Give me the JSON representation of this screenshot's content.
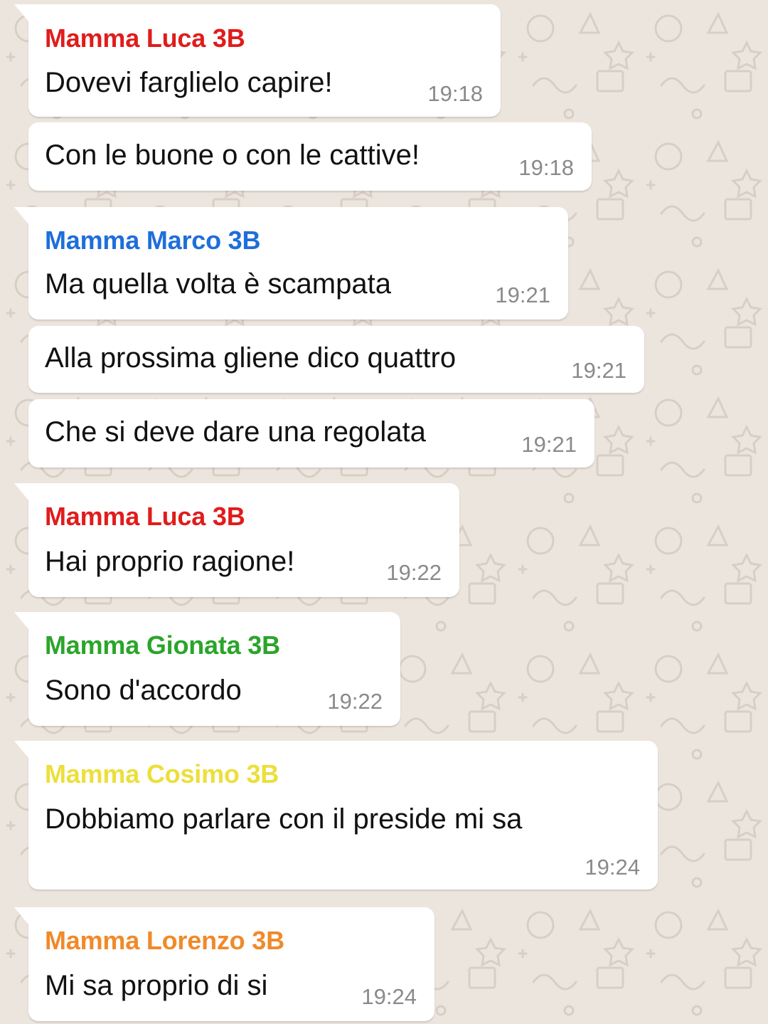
{
  "icons": {
    "wallpaper": "doodle-party-icons",
    "tail": "bubble-tail-icon"
  },
  "senders": {
    "luca": {
      "name": "Mamma Luca 3B",
      "color": "#e01c1c"
    },
    "marco": {
      "name": "Mamma Marco 3B",
      "color": "#1e6fd9"
    },
    "gionata": {
      "name": "Mamma Gionata 3B",
      "color": "#2aa52a"
    },
    "cosimo": {
      "name": "Mamma Cosimo 3B",
      "color": "#ecdf3a"
    },
    "lorenzo": {
      "name": "Mamma Lorenzo 3B",
      "color": "#f08a2a"
    }
  },
  "messages": [
    {
      "sender": "Mamma Luca 3B",
      "text": "Dovevi farglielo capire!",
      "time": "19:18"
    },
    {
      "text": "Con le buone o con le cattive!",
      "time": "19:18"
    },
    {
      "sender": "Mamma Marco 3B",
      "text": "Ma quella volta è scampata",
      "time": "19:21"
    },
    {
      "text": "Alla prossima gliene dico quattro",
      "time": "19:21"
    },
    {
      "text": "Che si deve dare una regolata",
      "time": "19:21"
    },
    {
      "sender": "Mamma Luca 3B",
      "text": "Hai proprio ragione!",
      "time": "19:22"
    },
    {
      "sender": "Mamma Gionata 3B",
      "text": "Sono d'accordo",
      "time": "19:22"
    },
    {
      "sender": "Mamma Cosimo 3B",
      "text": "Dobbiamo parlare con il preside mi sa",
      "time": "19:24"
    },
    {
      "sender": "Mamma Lorenzo 3B",
      "text": "Mi sa proprio di si",
      "time": "19:24"
    }
  ]
}
